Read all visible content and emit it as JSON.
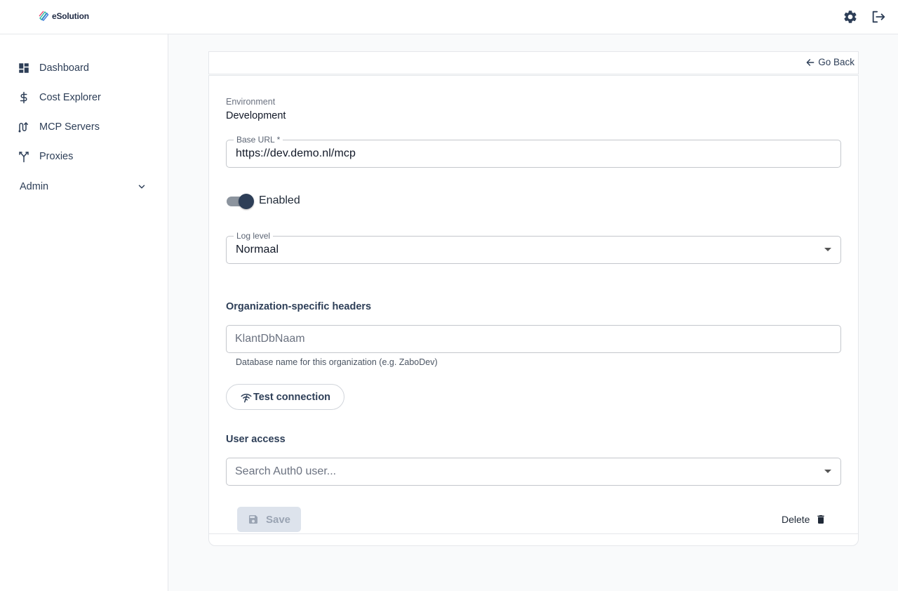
{
  "app": {
    "logo_text": "eSolution"
  },
  "topbar": {
    "settings_icon": "gear-icon",
    "logout_icon": "logout-icon"
  },
  "sidebar": {
    "items": [
      {
        "label": "Dashboard",
        "icon": "dashboard-icon"
      },
      {
        "label": "Cost Explorer",
        "icon": "dollar-icon"
      },
      {
        "label": "MCP Servers",
        "icon": "mcp-servers-icon"
      },
      {
        "label": "Proxies",
        "icon": "fork-icon"
      }
    ],
    "admin": {
      "label": "Admin",
      "icon": "chevron-down-icon"
    }
  },
  "header": {
    "go_back_label": "Go Back"
  },
  "form": {
    "environment": {
      "label": "Environment",
      "value": "Development"
    },
    "base_url": {
      "label": "Base URL *",
      "value": "https://dev.demo.nl/mcp"
    },
    "enabled": {
      "label": "Enabled",
      "checked": true
    },
    "log_level": {
      "label": "Log level",
      "value": "Normaal"
    },
    "org_headers": {
      "title": "Organization-specific headers",
      "placeholder": "KlantDbNaam",
      "helper": "Database name for this organization (e.g. ZaboDev)"
    },
    "test_connection_label": "Test connection",
    "user_access": {
      "title": "User access",
      "placeholder": "Search Auth0 user..."
    },
    "save_label": "Save",
    "delete_label": "Delete"
  },
  "colors": {
    "primary": "#2d3e57",
    "border": "#e5e7eb",
    "background": "#f9fafb",
    "disabled_button": "#dde3ec"
  }
}
